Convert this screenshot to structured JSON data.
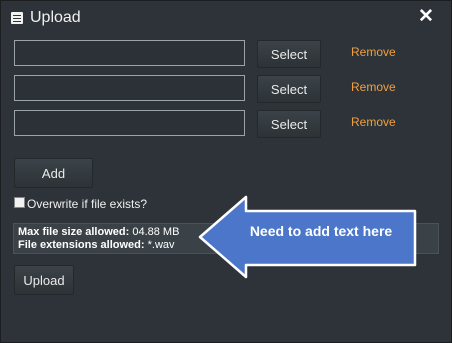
{
  "dialog": {
    "title": "Upload",
    "close_glyph": "✕",
    "title_icon": "list-document-icon",
    "close_icon": "close-icon"
  },
  "files": [
    {
      "value": "",
      "select_label": "Select",
      "remove_label": "Remove"
    },
    {
      "value": "",
      "select_label": "Select",
      "remove_label": "Remove"
    },
    {
      "value": "",
      "select_label": "Select",
      "remove_label": "Remove"
    }
  ],
  "add_label": "Add",
  "overwrite": {
    "label": "Overwrite if file exists?",
    "checked": false
  },
  "info": {
    "max_size_label": "Max file size allowed:",
    "max_size_value": "04.88 MB",
    "extensions_label": "File extensions allowed:",
    "extensions_value": "*.wav"
  },
  "upload_label": "Upload",
  "annotation": {
    "text": "Need to add text here",
    "fill": "#4b76c9",
    "border": "#ffffff"
  },
  "colors": {
    "background": "#2d3338",
    "remove_link": "#f0a040"
  }
}
